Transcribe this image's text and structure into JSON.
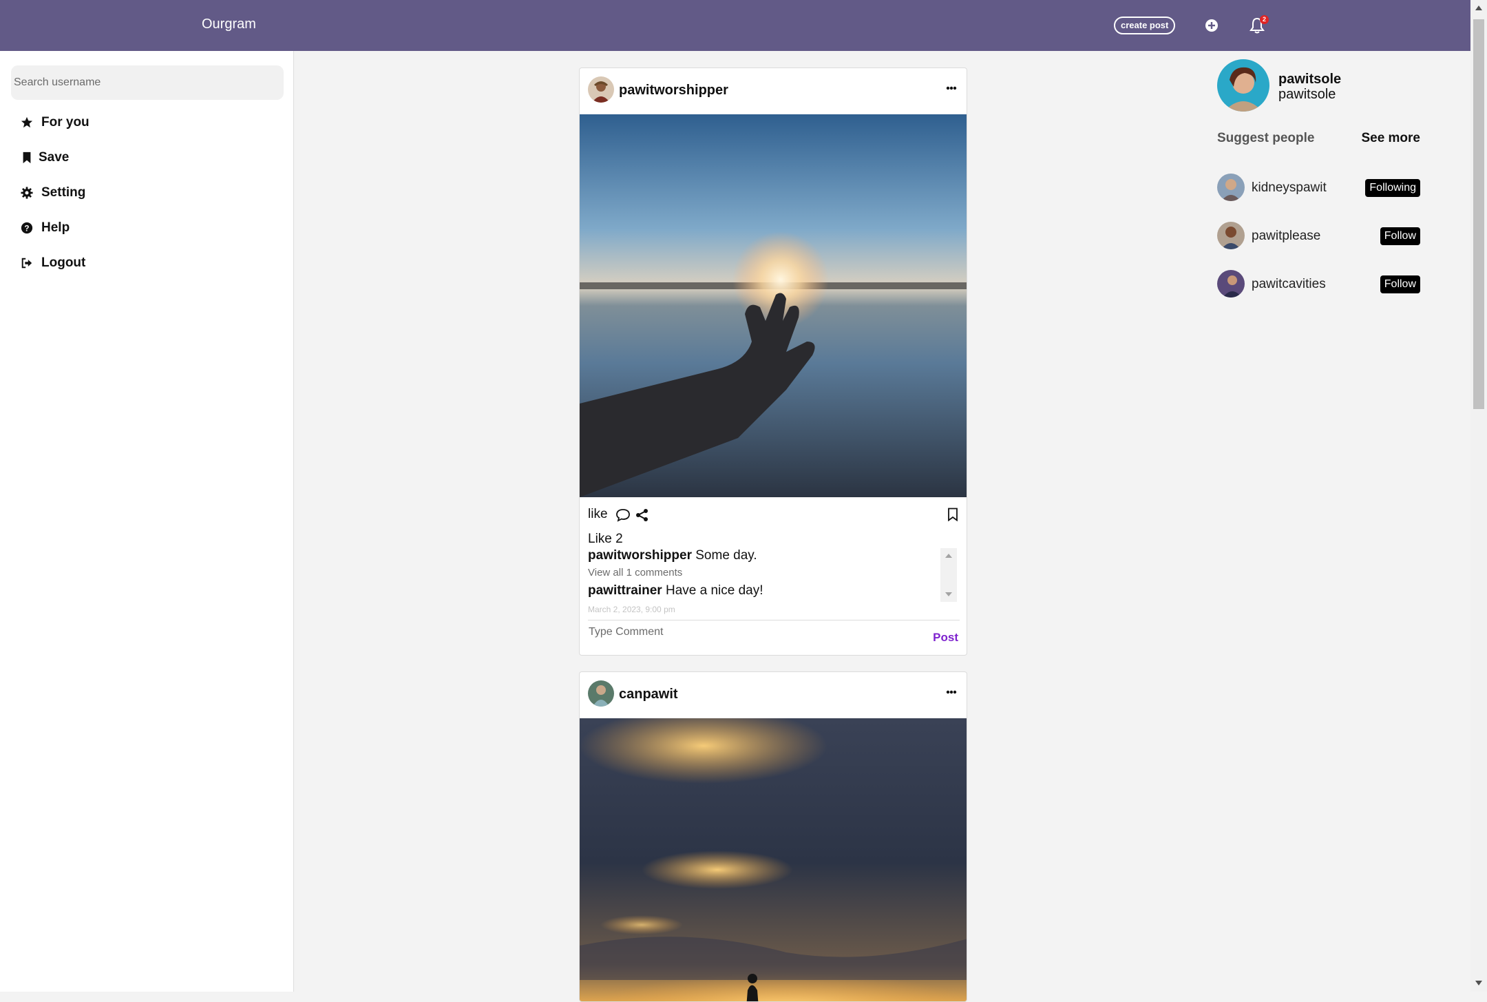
{
  "navbar": {
    "brand": "Ourgram",
    "create_post": "create post",
    "add_icon": "plus-circle-icon",
    "bell_icon": "bell-icon",
    "notification_count": "2",
    "bg_color": "#625a87"
  },
  "sidebar": {
    "search_placeholder": "Search username",
    "items": [
      {
        "label": "For you",
        "icon": "star-icon"
      },
      {
        "label": "Save",
        "icon": "bookmark-icon"
      },
      {
        "label": "Setting",
        "icon": "gear-icon"
      },
      {
        "label": "Help",
        "icon": "question-circle-icon"
      },
      {
        "label": "Logout",
        "icon": "sign-out-icon"
      }
    ]
  },
  "posts": [
    {
      "username": "pawitworshipper",
      "image_desc": "hand reaching toward sun over lake",
      "like_label": "like",
      "like_count": "Like 2",
      "caption_user": "pawitworshipper",
      "caption_text": "Some day.",
      "view_all": "View all 1 comments",
      "comment_user": "pawittrainer",
      "comment_text": "Have a nice day!",
      "timestamp": "March 2, 2023, 9:00 pm",
      "comment_placeholder": "Type Comment",
      "post_button": "Post"
    },
    {
      "username": "canpawit",
      "image_desc": "silhouette person under sunset sky"
    }
  ],
  "profile": {
    "name": "pawitsole",
    "handle": "pawitsole"
  },
  "suggestions": {
    "title": "Suggest people",
    "see_more": "See more",
    "people": [
      {
        "username": "kidneyspawit",
        "action": "Following"
      },
      {
        "username": "pawitplease",
        "action": "Follow"
      },
      {
        "username": "pawitcavities",
        "action": "Follow"
      }
    ]
  },
  "colors": {
    "accent_purple": "#7e22ce",
    "badge_red": "#e02424"
  }
}
